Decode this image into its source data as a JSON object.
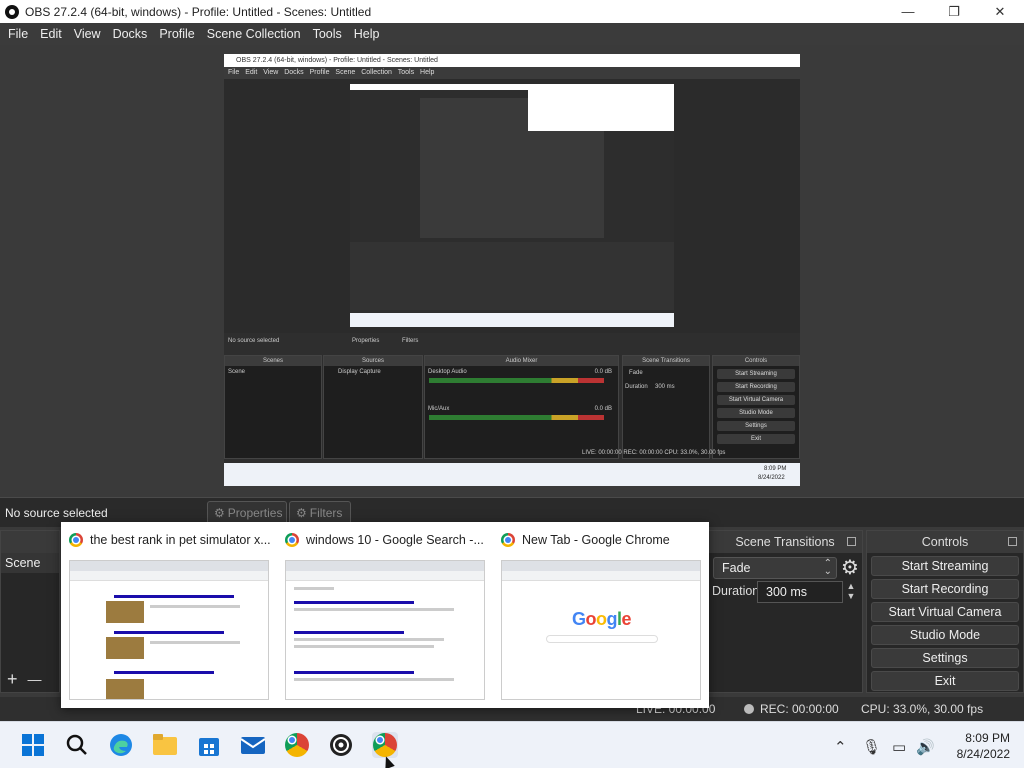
{
  "window": {
    "title": "OBS 27.2.4 (64-bit, windows) - Profile: Untitled - Scenes: Untitled",
    "minimize": "—",
    "maximize": "❐",
    "close": "✕"
  },
  "menu": [
    "File",
    "Edit",
    "View",
    "Docks",
    "Profile",
    "Scene Collection",
    "Tools",
    "Help"
  ],
  "preview": {
    "nested_title": "OBS 27.2.4 (64-bit, windows) - Profile: Untitled - Scenes: Untitled",
    "nested_menu": "File Edit View Docks Profile Scene Collection Tools Help",
    "no_source": "No source selected",
    "properties": "Properties",
    "filters": "Filters",
    "scenes_head": "Scenes",
    "sources_head": "Sources",
    "mixer_head": "Audio Mixer",
    "transitions_head": "Scene Transitions",
    "controls_head": "Controls",
    "scene_item": "Scene",
    "source_item": "Display Capture",
    "desktop_audio": "Desktop Audio",
    "mic_aux": "Mic/Aux",
    "db_value": "0.0 dB",
    "fade": "Fade",
    "duration_label": "Duration",
    "duration_value": "300 ms",
    "controls": [
      "Start Streaming",
      "Start Recording",
      "Start Virtual Camera",
      "Studio Mode",
      "Settings",
      "Exit"
    ],
    "status": "LIVE: 00:00:00   REC: 00:00:00   CPU: 33.0%, 30.00 fps",
    "clock_time": "8:09 PM",
    "clock_date": "8/24/2022"
  },
  "context_bar": {
    "no_source": "No source selected",
    "properties": "Properties",
    "filters": "Filters"
  },
  "scenes": {
    "item": "Scene",
    "add": "+",
    "remove": "—"
  },
  "transitions": {
    "title": "Scene Transitions",
    "selected": "Fade",
    "duration_label": "Duration",
    "duration_value": "300 ms"
  },
  "controls": {
    "title": "Controls",
    "buttons": [
      "Start Streaming",
      "Start Recording",
      "Start Virtual Camera",
      "Studio Mode",
      "Settings",
      "Exit"
    ]
  },
  "status": {
    "live": "LIVE: 00:00:00",
    "rec": "REC: 00:00:00",
    "cpu": "CPU: 33.0%, 30.00 fps"
  },
  "chrome_popup": {
    "tabs": [
      {
        "title": "the best rank in pet simulator x..."
      },
      {
        "title": "windows 10 - Google Search -..."
      },
      {
        "title": "New Tab - Google Chrome"
      }
    ],
    "google_logo": "Google"
  },
  "taskbar": {
    "time": "8:09 PM",
    "date": "8/24/2022",
    "icons": [
      "start-icon",
      "search-icon",
      "edge-icon",
      "file-explorer-icon",
      "store-icon",
      "mail-icon",
      "chrome-icon",
      "obs-icon",
      "chrome-icon"
    ],
    "tray": [
      "chevron-up-icon",
      "microphone-icon",
      "network-icon",
      "speaker-icon"
    ]
  }
}
